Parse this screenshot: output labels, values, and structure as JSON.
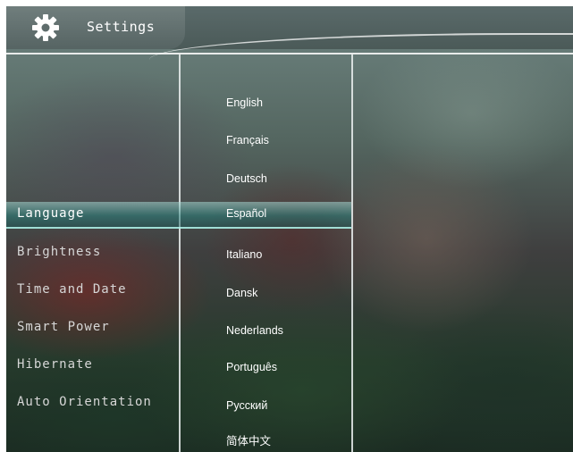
{
  "header": {
    "title": "Settings",
    "icon": "gear-icon"
  },
  "colors": {
    "highlight": "#3e8f8c",
    "text": "#ffffff",
    "header": "#566463"
  },
  "menu": {
    "selected_index": 0,
    "items": [
      {
        "label": "Language"
      },
      {
        "label": "Brightness"
      },
      {
        "label": "Time and Date"
      },
      {
        "label": "Smart Power"
      },
      {
        "label": "Hibernate"
      },
      {
        "label": "Auto Orientation"
      }
    ]
  },
  "languages": {
    "selected_index": 3,
    "items": [
      {
        "label": "English"
      },
      {
        "label": "Français"
      },
      {
        "label": "Deutsch"
      },
      {
        "label": "Español"
      },
      {
        "label": "Italiano"
      },
      {
        "label": "Dansk"
      },
      {
        "label": "Nederlands"
      },
      {
        "label": "Português"
      },
      {
        "label": "Русский"
      },
      {
        "label": "简体中文"
      }
    ]
  }
}
